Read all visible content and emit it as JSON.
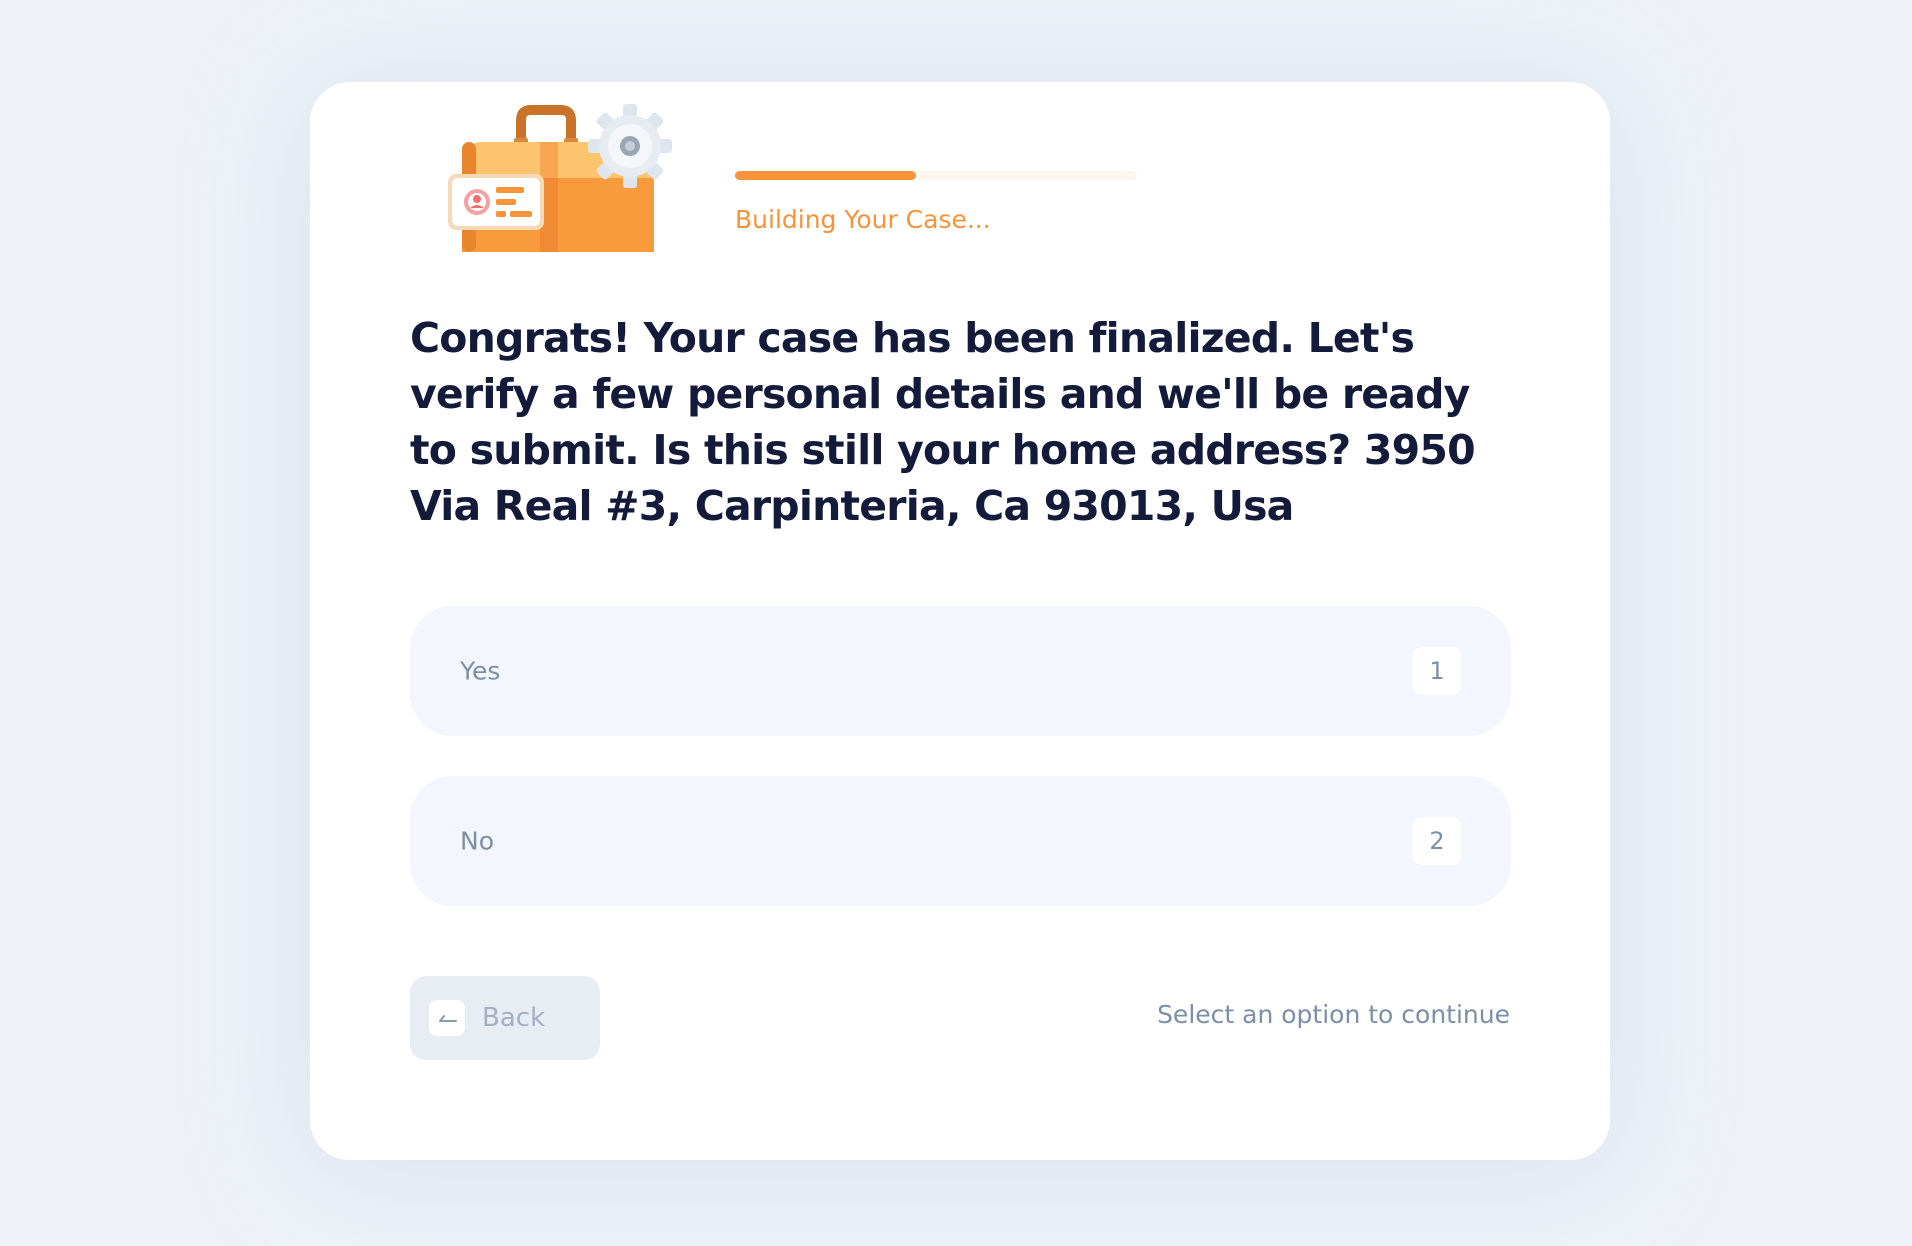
{
  "progress": {
    "label": "Building Your Case...",
    "fraction": 0.45,
    "color": "#f7933a"
  },
  "question": {
    "text": "Congrats! Your case has been finalized. Let's verify a few personal details and we'll be ready to submit. Is this still your home address? 3950 Via Real #3, Carpinteria, Ca 93013, Usa"
  },
  "options": [
    {
      "label": "Yes",
      "key": "1"
    },
    {
      "label": "No",
      "key": "2"
    }
  ],
  "footer": {
    "back_label": "Back",
    "back_icon": "arrow-left-icon",
    "hint": "Select an option to continue"
  },
  "illustration": {
    "icon": "briefcase-with-gear-icon"
  }
}
